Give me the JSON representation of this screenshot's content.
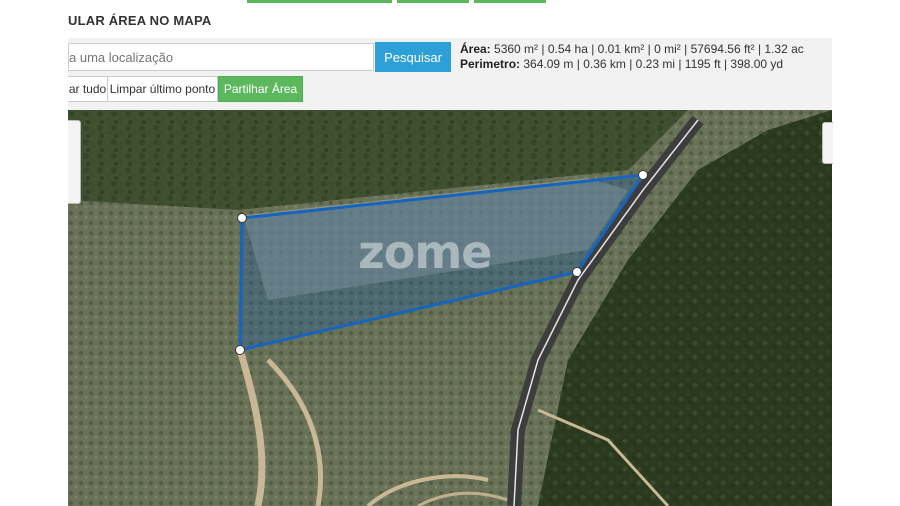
{
  "header": {
    "title": "ULAR ÁREA NO MAPA"
  },
  "search": {
    "placeholder": "a uma localização",
    "button_label": "Pesquisar"
  },
  "stats": {
    "area_label": "Área:",
    "area_value": "5360 m² | 0.54 ha | 0.01 km² | 0 mi² | 57694.56 ft² | 1.32 ac",
    "perimeter_label": "Perimetro:",
    "perimeter_value": "364.09 m | 0.36 km | 0.23 mi | 1195 ft | 398.00 yd"
  },
  "buttons": {
    "clear_all": "ar tudo",
    "clear_last": "Limpar último ponto",
    "share": "Partilhar Área"
  },
  "map": {
    "watermark": "zome"
  },
  "colors": {
    "accent_green": "#5cb85c",
    "search_blue": "#2ea0d8",
    "polygon_stroke": "#1565c0"
  }
}
